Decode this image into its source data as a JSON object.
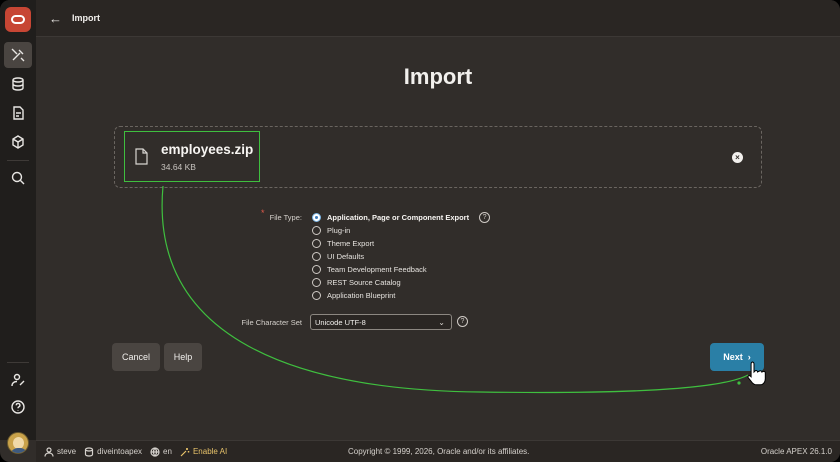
{
  "topbar": {
    "back_icon": "arrow-left-icon",
    "title": "Import"
  },
  "sidebar": {
    "logo": "oracle-logo",
    "items": [
      {
        "name": "app-builder",
        "icon": "tools-icon",
        "active": true
      },
      {
        "name": "sql-workshop",
        "icon": "database-icon"
      },
      {
        "name": "team-development",
        "icon": "document-edit-icon"
      },
      {
        "name": "gallery",
        "icon": "cube-icon"
      },
      {
        "name": "search",
        "icon": "search-icon"
      }
    ],
    "bottom_items": [
      {
        "name": "administration",
        "icon": "user-settings-icon"
      },
      {
        "name": "help",
        "icon": "help-circle-icon"
      }
    ]
  },
  "page": {
    "title": "Import"
  },
  "upload": {
    "file_name": "employees.zip",
    "file_size": "34.64 KB",
    "remove_icon": "close-circle-icon"
  },
  "file_type": {
    "label": "File Type:",
    "required": "*",
    "options": [
      {
        "label": "Application, Page or Component Export",
        "checked": true
      },
      {
        "label": "Plug-in",
        "checked": false
      },
      {
        "label": "Theme Export",
        "checked": false
      },
      {
        "label": "UI Defaults",
        "checked": false
      },
      {
        "label": "Team Development Feedback",
        "checked": false
      },
      {
        "label": "REST Source Catalog",
        "checked": false
      },
      {
        "label": "Application Blueprint",
        "checked": false
      }
    ],
    "help": "?"
  },
  "charset": {
    "label": "File Character Set",
    "value": "Unicode UTF-8",
    "help": "?"
  },
  "buttons": {
    "cancel": "Cancel",
    "help": "Help",
    "next": "Next",
    "next_icon": "chevron-right-icon"
  },
  "footer": {
    "user": "steve",
    "workspace": "diveintoapex",
    "language": "en",
    "ai": "Enable AI",
    "copyright": "Copyright © 1999, 2026, Oracle and/or its affiliates.",
    "version": "Oracle APEX 26.1.0"
  },
  "colors": {
    "accent": "#2a7fa6",
    "highlight": "#3fbf3f",
    "brand": "#c74634"
  }
}
